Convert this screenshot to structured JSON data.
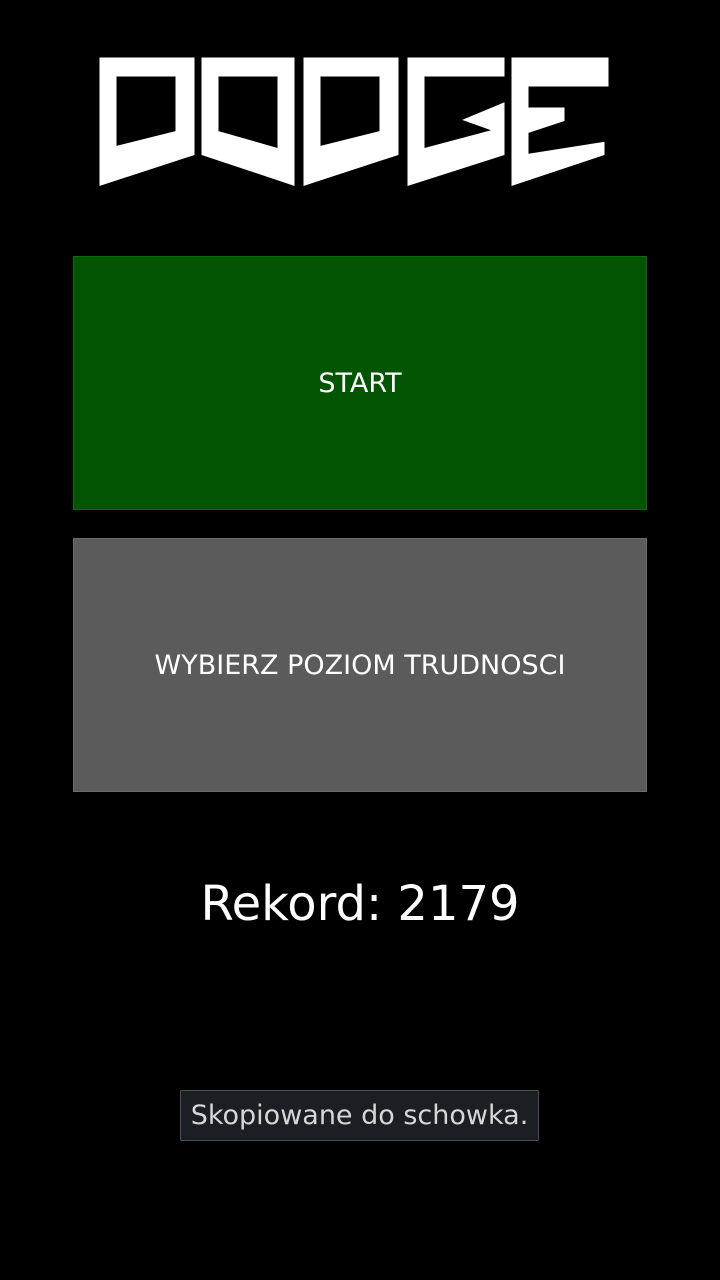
{
  "app": {
    "logo_text": "DODGE"
  },
  "menu": {
    "start_label": "START",
    "difficulty_label": "WYBIERZ POZIOM TRUDNOSCI"
  },
  "record": {
    "label": "Rekord:",
    "value": "2179",
    "display": "Rekord: 2179"
  },
  "toast": {
    "message": "Skopiowane do schowka."
  },
  "colors": {
    "background": "#000000",
    "start_button": "#035503",
    "difficulty_button": "#5b5b5b",
    "text": "#ffffff",
    "toast_background": "#1b1f24"
  }
}
